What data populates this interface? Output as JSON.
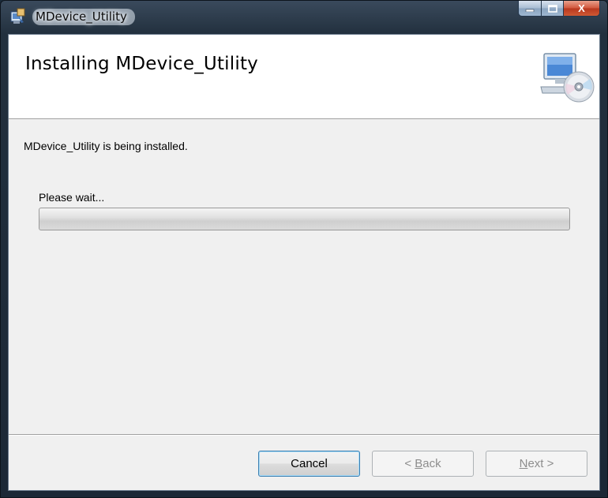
{
  "window": {
    "title": "MDevice_Utility",
    "app_icon": "installer-icon"
  },
  "caption_buttons": {
    "minimize_icon": "minimize-icon",
    "maximize_icon": "maximize-icon",
    "close_icon": "close-icon",
    "close_label": "X"
  },
  "banner": {
    "title": "Installing MDevice_Utility",
    "icon": "computer-disc-icon"
  },
  "body": {
    "status_text": "MDevice_Utility is being installed.",
    "wait_text": "Please wait...",
    "progress": 0
  },
  "buttons": {
    "cancel": "Cancel",
    "back_prefix": "< ",
    "back_mnemonic": "B",
    "back_rest": "ack",
    "next_mnemonic": "N",
    "next_rest": "ext",
    "next_suffix": " >"
  },
  "colors": {
    "close_button": "#c9462a",
    "default_button_border": "#3c7fb1",
    "client_background": "#f0f0f0"
  }
}
